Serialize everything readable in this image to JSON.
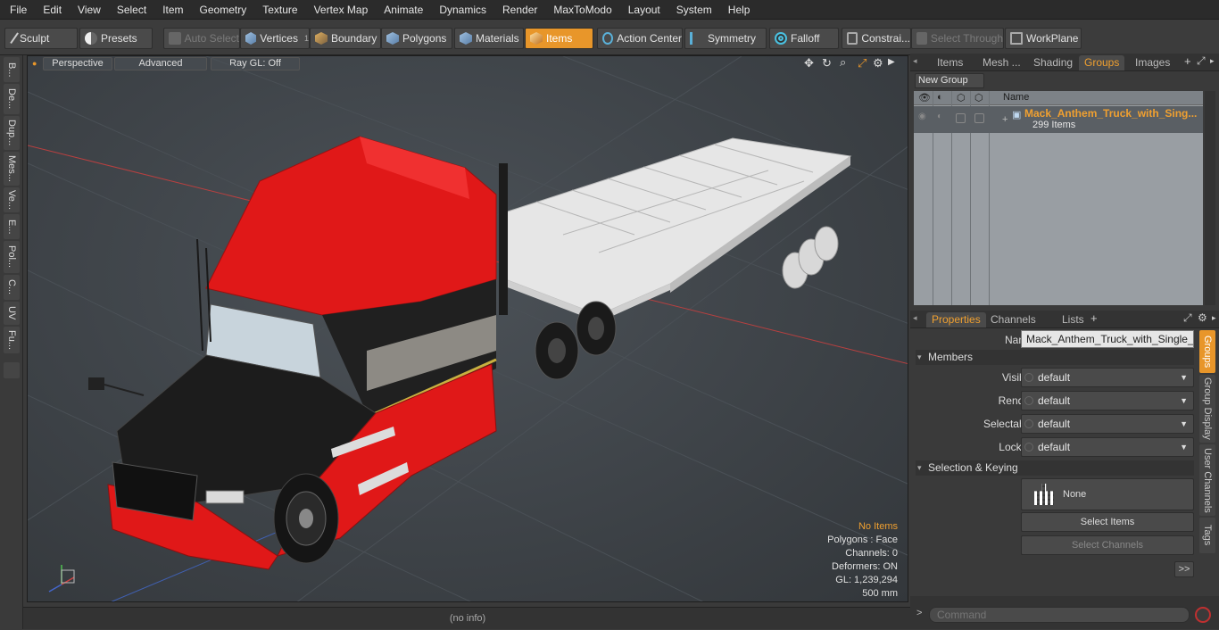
{
  "menu": [
    "File",
    "Edit",
    "View",
    "Select",
    "Item",
    "Geometry",
    "Texture",
    "Vertex Map",
    "Animate",
    "Dynamics",
    "Render",
    "MaxToModo",
    "Layout",
    "System",
    "Help"
  ],
  "toolbar": {
    "sculpt": "Sculpt",
    "presets": "Presets",
    "auto_select": "Auto Select",
    "vertices": "Vertices",
    "vertices_count": "1",
    "boundary": "Boundary",
    "polygons": "Polygons",
    "materials": "Materials",
    "items": "Items",
    "action_center": "Action Center",
    "symmetry": "Symmetry",
    "falloff": "Falloff",
    "constraints": "Constrai...",
    "select_through": "Select Through",
    "workplane": "WorkPlane"
  },
  "left_tabs": [
    "B...",
    "De...",
    "Dup...",
    "Mes...",
    "Ve...",
    "E...",
    "Pol...",
    "C...",
    "UV",
    "Fu..."
  ],
  "viewport": {
    "perspective": "Perspective",
    "advanced": "Advanced",
    "raygl": "Ray GL: Off",
    "info": {
      "selection": "No Items",
      "polygons": "Polygons : Face",
      "channels": "Channels: 0",
      "deformers": "Deformers: ON",
      "gl": "GL: 1,239,294",
      "scale": "500 mm"
    },
    "info_color": "#f0a030"
  },
  "status_text": "(no info)",
  "top_panel": {
    "tabs": [
      "Items",
      "Mesh ...",
      "Shading",
      "Groups",
      "Images"
    ],
    "active_tab": "Groups",
    "new_group": "New Group",
    "col_name": "Name",
    "group": {
      "name": "Mack_Anthem_Truck_with_Sing...",
      "count": "299 Items"
    }
  },
  "properties": {
    "tabs": [
      "Properties",
      "Channels",
      "Lists"
    ],
    "name_label": "Name",
    "name_value": "Mack_Anthem_Truck_with_Single_Dro",
    "members_section": "Members",
    "visible_label": "Visible",
    "visible_value": "default",
    "render_label": "Render",
    "render_value": "default",
    "selectable_label": "Selectable",
    "selectable_value": "default",
    "locked_label": "Locked",
    "locked_value": "default",
    "sel_section": "Selection & Keying",
    "none_label": "None",
    "select_items": "Select Items",
    "select_channels": "Select Channels",
    "more": ">>",
    "side_tabs": [
      "Groups",
      "Group Display",
      "User Channels",
      "Tags"
    ]
  },
  "command_placeholder": "Command",
  "accent": "#e8962a"
}
